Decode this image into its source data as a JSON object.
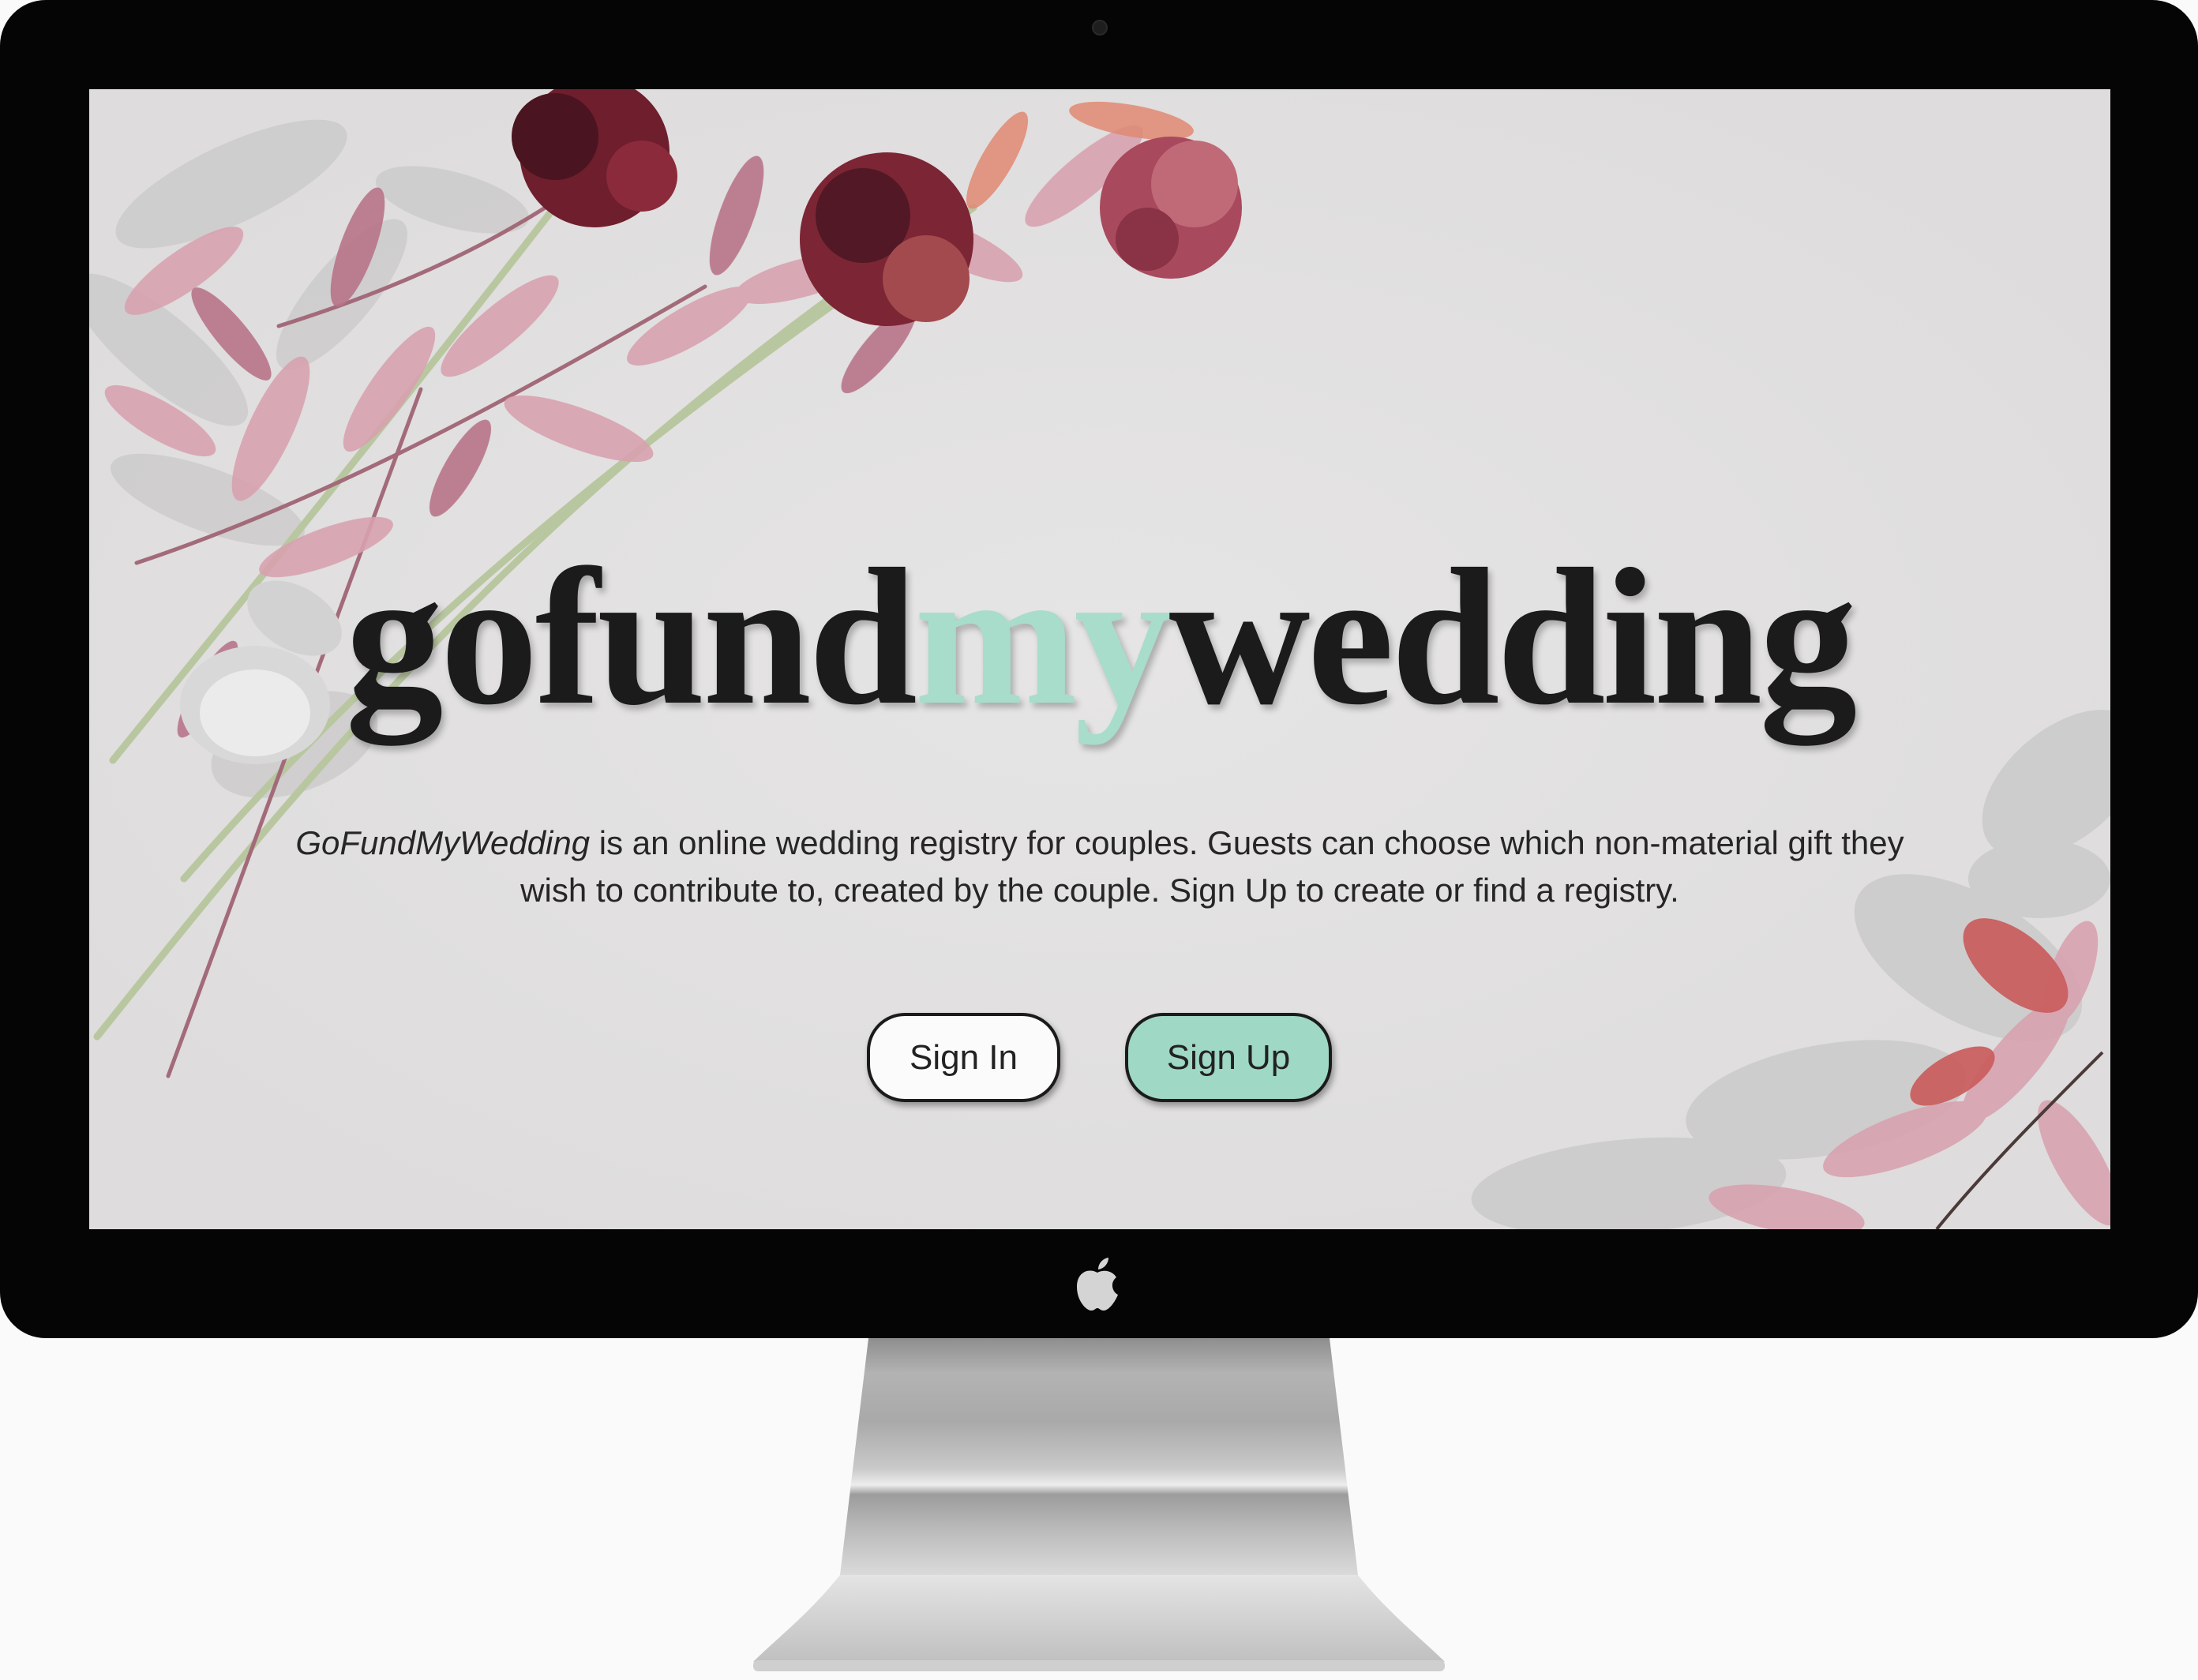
{
  "brand": {
    "part1": "gofund",
    "part2": "my",
    "part3": "wedding",
    "accent_color": "#a8dccb"
  },
  "description": {
    "italic_name": "GoFundMyWedding",
    "text": " is an online wedding registry for couples. Guests can choose which non-material gift they wish to contribute to, created by the couple. Sign Up to create or find a registry."
  },
  "buttons": {
    "sign_in": "Sign In",
    "sign_up": "Sign Up",
    "sign_up_color": "#9fd8c4"
  },
  "device": {
    "logo_icon": "apple-logo-icon",
    "camera_icon": "camera-dot-icon"
  }
}
